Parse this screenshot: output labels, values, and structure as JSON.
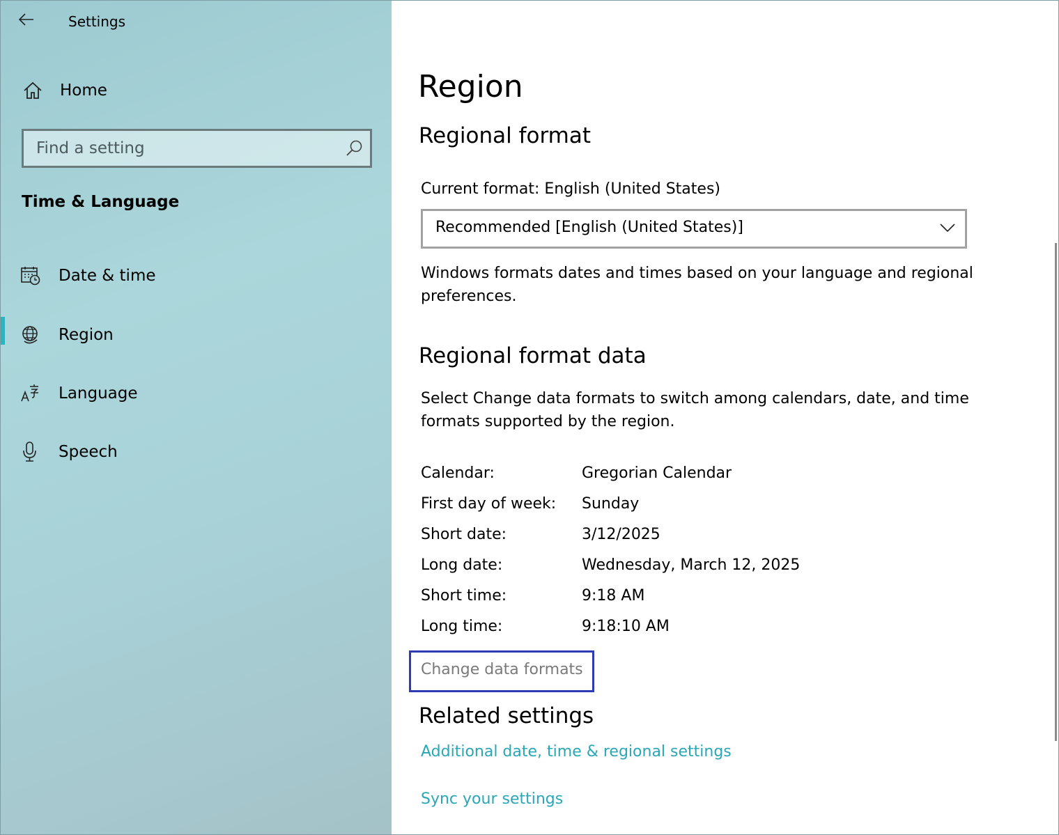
{
  "window": {
    "app_title": "Settings",
    "controls": {
      "minimize": "minimize-icon",
      "maximize": "maximize-icon",
      "close": "close-icon"
    }
  },
  "sidebar": {
    "home_label": "Home",
    "search_placeholder": "Find a setting",
    "section_title": "Time & Language",
    "items": [
      {
        "label": "Date & time",
        "icon": "calendar-clock-icon"
      },
      {
        "label": "Region",
        "icon": "globe-icon",
        "active": true
      },
      {
        "label": "Language",
        "icon": "language-icon"
      },
      {
        "label": "Speech",
        "icon": "microphone-icon"
      }
    ],
    "accent": "#2eb4c1"
  },
  "main": {
    "page_title": "Region",
    "regional_format": {
      "heading": "Regional format",
      "current_format": "Current format: English (United States)",
      "dropdown_value": "Recommended [English (United States)]",
      "description": "Windows formats dates and times based on your language and regional preferences."
    },
    "format_data": {
      "heading": "Regional format data",
      "description": "Select Change data formats to switch among calendars, date, and time formats supported by the region.",
      "rows": [
        {
          "key": "Calendar:",
          "value": "Gregorian Calendar"
        },
        {
          "key": "First day of week:",
          "value": "Sunday"
        },
        {
          "key": "Short date:",
          "value": "3/12/2025"
        },
        {
          "key": "Long date:",
          "value": "Wednesday, March 12, 2025"
        },
        {
          "key": "Short time:",
          "value": "9:18 AM"
        },
        {
          "key": "Long time:",
          "value": "9:18:10 AM"
        }
      ],
      "change_button": "Change data formats"
    },
    "related": {
      "heading": "Related settings",
      "links": [
        "Additional date, time & regional settings",
        "Sync your settings"
      ]
    },
    "link_color": "#2aa7b6",
    "focus_color": "#2d3bb5"
  }
}
